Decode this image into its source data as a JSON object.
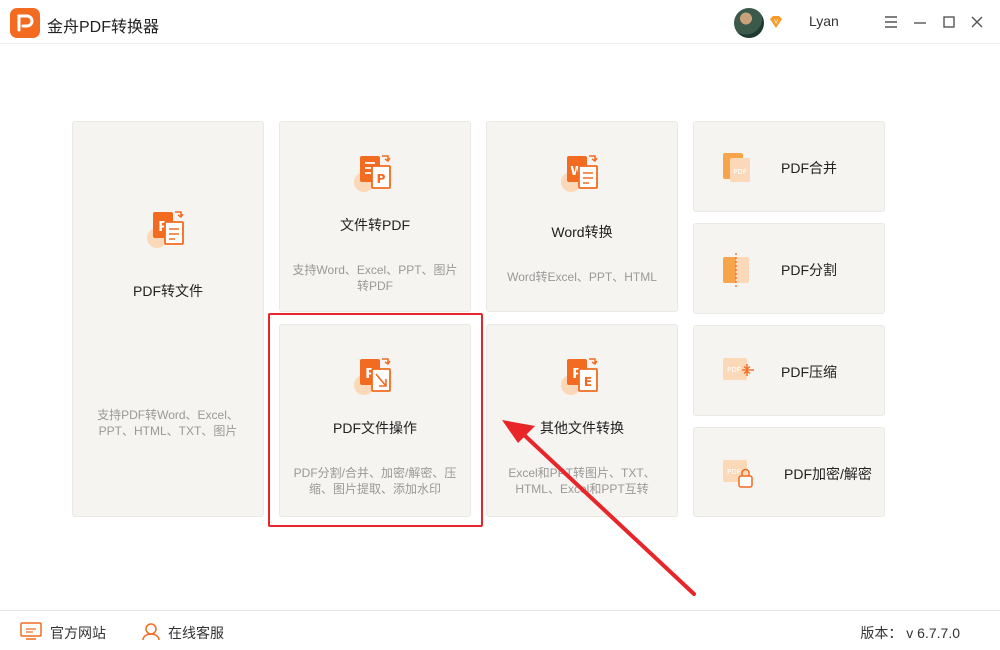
{
  "app": {
    "title": "金舟PDF转换器",
    "username": "Lyan"
  },
  "cards": {
    "pdf_to_file": {
      "label": "PDF转文件",
      "desc": "支持PDF转Word、Excel、PPT、HTML、TXT、图片"
    },
    "file_to_pdf": {
      "label": "文件转PDF",
      "desc": "支持Word、Excel、PPT、图片转PDF"
    },
    "word_convert": {
      "label": "Word转换",
      "desc": "Word转Excel、PPT、HTML"
    },
    "pdf_ops": {
      "label": "PDF文件操作",
      "desc": "PDF分割/合并、加密/解密、压缩、图片提取、添加水印"
    },
    "other_convert": {
      "label": "其他文件转换",
      "desc": "Excel和PPT转图片、TXT、HTML、Excel和PPT互转"
    }
  },
  "tools": {
    "merge": {
      "label": "PDF合并"
    },
    "split": {
      "label": "PDF分割"
    },
    "compress": {
      "label": "PDF压缩"
    },
    "encrypt": {
      "label": "PDF加密/解密"
    }
  },
  "footer": {
    "website": "官方网站",
    "support": "在线客服",
    "version": "版本： v 6.7.7.0"
  },
  "colors": {
    "accent": "#f26b21",
    "highlight": "#e8262a",
    "card_bg": "#f5f4f1"
  },
  "icons": [
    "app-logo-icon",
    "vip-icon",
    "menu-icon",
    "minimize-icon",
    "maximize-icon",
    "close-icon",
    "monitor-icon",
    "headset-icon"
  ]
}
